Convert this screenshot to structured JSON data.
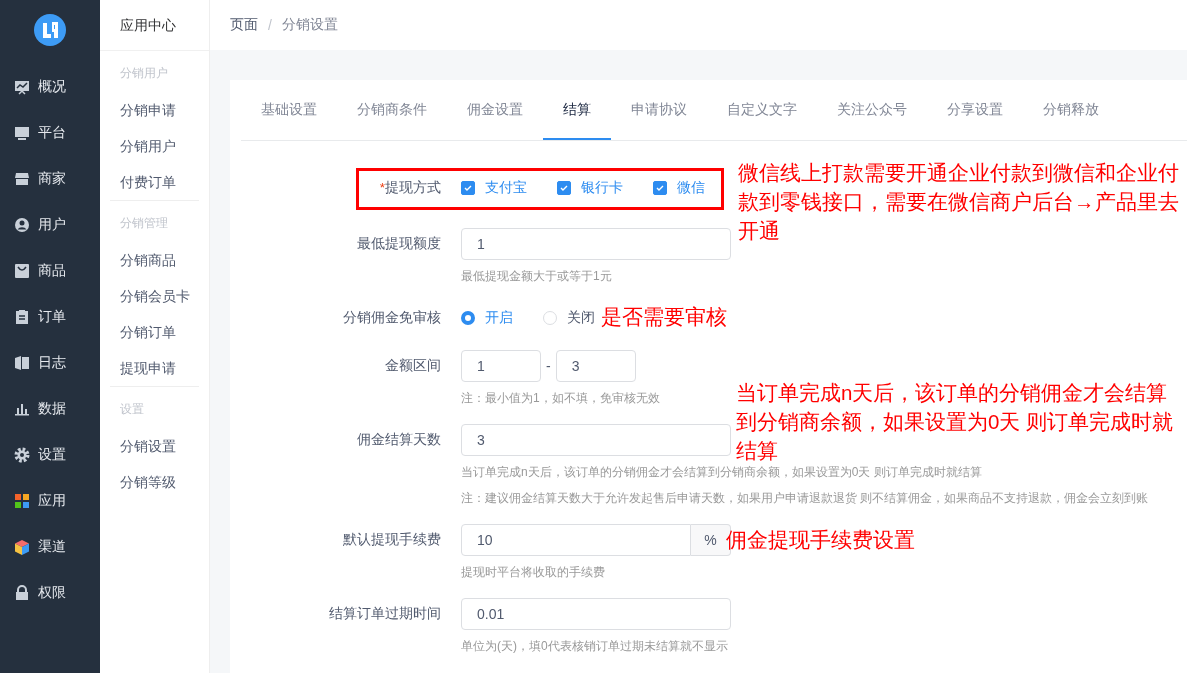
{
  "main_nav": [
    {
      "label": "概况"
    },
    {
      "label": "平台"
    },
    {
      "label": "商家"
    },
    {
      "label": "用户"
    },
    {
      "label": "商品"
    },
    {
      "label": "订单"
    },
    {
      "label": "日志"
    },
    {
      "label": "数据"
    },
    {
      "label": "设置"
    },
    {
      "label": "应用"
    },
    {
      "label": "渠道"
    },
    {
      "label": "权限"
    }
  ],
  "sub_nav": {
    "title": "应用中心",
    "groups": [
      {
        "heading": "分销用户",
        "items": [
          {
            "label": "分销申请"
          },
          {
            "label": "分销用户"
          },
          {
            "label": "付费订单"
          }
        ]
      },
      {
        "heading": "分销管理",
        "items": [
          {
            "label": "分销商品"
          },
          {
            "label": "分销会员卡"
          },
          {
            "label": "分销订单"
          },
          {
            "label": "提现申请"
          }
        ]
      },
      {
        "heading": "设置",
        "items": [
          {
            "label": "分销设置"
          },
          {
            "label": "分销等级"
          }
        ]
      }
    ]
  },
  "breadcrumb": {
    "items": [
      "页面",
      "分销设置"
    ],
    "separator": "/"
  },
  "tabs": [
    {
      "label": "基础设置",
      "selected": false
    },
    {
      "label": "分销商条件",
      "selected": false
    },
    {
      "label": "佣金设置",
      "selected": false
    },
    {
      "label": "结算",
      "selected": true
    },
    {
      "label": "申请协议",
      "selected": false
    },
    {
      "label": "自定义文字",
      "selected": false
    },
    {
      "label": "关注公众号",
      "selected": false
    },
    {
      "label": "分享设置",
      "selected": false
    },
    {
      "label": "分销释放",
      "selected": false
    }
  ],
  "form": [
    {
      "kind": "checkboxes",
      "label": "提现方式",
      "required_mark": "*",
      "options": [
        {
          "label": "支付宝",
          "checked": true
        },
        {
          "label": "银行卡",
          "checked": true
        },
        {
          "label": "微信",
          "checked": true
        }
      ]
    },
    {
      "kind": "input",
      "label": "最低提现额度",
      "value": "1",
      "help": [
        "最低提现金额大于或等于1元"
      ]
    },
    {
      "kind": "radios",
      "label": "分销佣金免审核",
      "options": [
        {
          "label": "开启",
          "selected": true
        },
        {
          "label": "关闭",
          "selected": false
        }
      ]
    },
    {
      "kind": "range",
      "label": "金额区间",
      "from": "1",
      "separator": "-",
      "to": "3",
      "help": [
        "注：最小值为1，如不填，免审核无效"
      ]
    },
    {
      "kind": "input",
      "label": "佣金结算天数",
      "value": "3",
      "help": [
        "当订单完成n天后，该订单的分销佣金才会结算到分销商余额，如果设置为0天 则订单完成时就结算",
        "注：建议佣金结算天数大于允许发起售后申请天数，如果用户申请退款退货 则不结算佣金，如果商品不支持退款，佣金会立刻到账"
      ]
    },
    {
      "kind": "addon",
      "label": "默认提现手续费",
      "value": "10",
      "addon": "%",
      "help": [
        "提现时平台将收取的手续费"
      ]
    },
    {
      "kind": "input",
      "label": "结算订单过期时间",
      "value": "0.01",
      "help": [
        "单位为(天)，填0代表核销订单过期未结算就不显示"
      ]
    }
  ],
  "annotations": [
    {
      "text": "微信线上打款需要开通企业付款到微信和企业付款到零钱接口，需要在微信商户后台→产品里去开通"
    },
    {
      "text": "是否需要审核"
    },
    {
      "text": "当订单完成n天后，该订单的分销佣金才会结算到分销商余额，如果设置为0天 则订单完成时就结算"
    },
    {
      "text": "佣金提现手续费设置"
    }
  ]
}
